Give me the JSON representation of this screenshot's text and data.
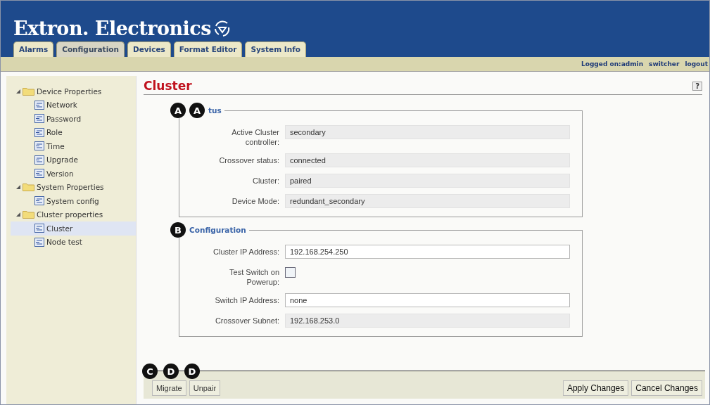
{
  "header": {
    "logo": "Extron. Electronics"
  },
  "tabs": [
    {
      "label": "Alarms",
      "selected": false
    },
    {
      "label": "Configuration",
      "selected": true
    },
    {
      "label": "Devices",
      "selected": false
    },
    {
      "label": "Format Editor",
      "selected": false
    },
    {
      "label": "System Info",
      "selected": false
    }
  ],
  "user_bar": {
    "logged_on": "Logged on:admin",
    "user": "switcher",
    "logout": "logout"
  },
  "sidebar": {
    "items": [
      {
        "label": "Device Properties",
        "expanded": true,
        "selected": false,
        "children": [
          {
            "label": "Network",
            "selected": false
          },
          {
            "label": "Password",
            "selected": false
          },
          {
            "label": "Role",
            "selected": false
          },
          {
            "label": "Time",
            "selected": false
          },
          {
            "label": "Upgrade",
            "selected": false
          },
          {
            "label": "Version",
            "selected": false
          }
        ]
      },
      {
        "label": "System Properties",
        "expanded": true,
        "selected": false,
        "children": [
          {
            "label": "System config",
            "selected": false
          }
        ]
      },
      {
        "label": "Cluster properties",
        "expanded": true,
        "selected": false,
        "children": [
          {
            "label": "Cluster",
            "selected": true
          },
          {
            "label": "Node test",
            "selected": false
          }
        ]
      }
    ]
  },
  "page": {
    "title": "Cluster",
    "help": "?"
  },
  "sections": [
    {
      "callouts": [
        "A",
        "A"
      ],
      "legend": "tus",
      "fields": [
        {
          "label": "Active Cluster controller:",
          "kind": "readonly",
          "value": "secondary"
        },
        {
          "label": "Crossover status:",
          "kind": "readonly",
          "value": "connected"
        },
        {
          "label": "Cluster:",
          "kind": "readonly",
          "value": "paired"
        },
        {
          "label": "Device Mode:",
          "kind": "readonly",
          "value": "redundant_secondary"
        }
      ]
    },
    {
      "callouts": [
        "B"
      ],
      "legend": "Configuration",
      "fields": [
        {
          "label": "Cluster IP Address:",
          "kind": "input",
          "value": "192.168.254.250"
        },
        {
          "label": "Test Switch on Powerup:",
          "kind": "checkbox",
          "checked": false
        },
        {
          "label": "Switch IP Address:",
          "kind": "input",
          "value": "none"
        },
        {
          "label": "Crossover Subnet:",
          "kind": "readonly",
          "value": "192.168.253.0"
        }
      ]
    }
  ],
  "left_buttons": [
    "Migrate",
    "Unpair"
  ],
  "right_buttons": [
    "Apply Changes",
    "Cancel Changes"
  ],
  "button_callouts": [
    "C",
    "D",
    "D"
  ]
}
